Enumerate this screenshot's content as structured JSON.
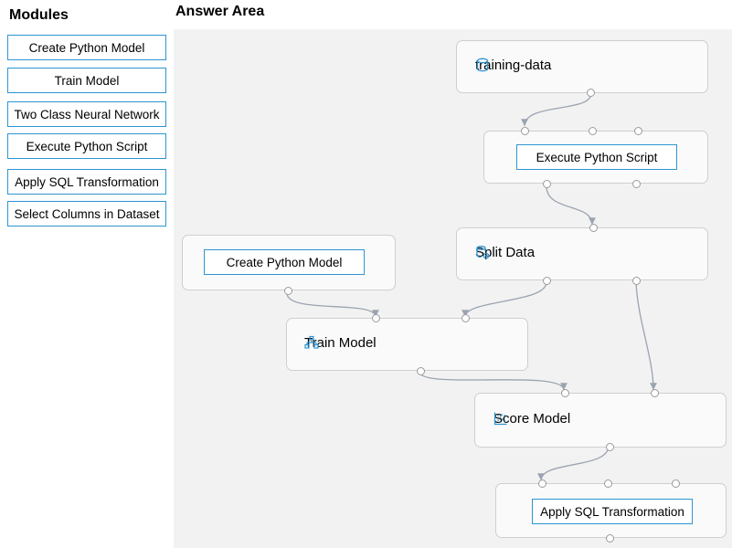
{
  "modules_panel": {
    "title": "Modules",
    "items": [
      "Create Python Model",
      "Train Model",
      "Two Class Neural Network",
      "Execute Python Script",
      "Apply SQL Transformation",
      "Select Columns in Dataset"
    ]
  },
  "answer_area": {
    "title": "Answer Area",
    "nodes": {
      "training_data": "training-data",
      "execute_python": {
        "slot_value": "Execute Python Script"
      },
      "split_data": "Split Data",
      "create_python_model": {
        "slot_value": "Create Python Model"
      },
      "train_model": "Train Model",
      "score_model": "Score Model",
      "apply_sql": {
        "slot_value": "Apply SQL Transformation"
      }
    },
    "icons": {
      "training_data": "database-icon",
      "split_data": "split-data-icon",
      "train_model": "train-model-icon",
      "score_model": "scatter-plot-icon"
    }
  },
  "colors": {
    "accent": "#2e95d3",
    "canvas_bg": "#f2f2f2",
    "connector": "#9aa3b0"
  }
}
